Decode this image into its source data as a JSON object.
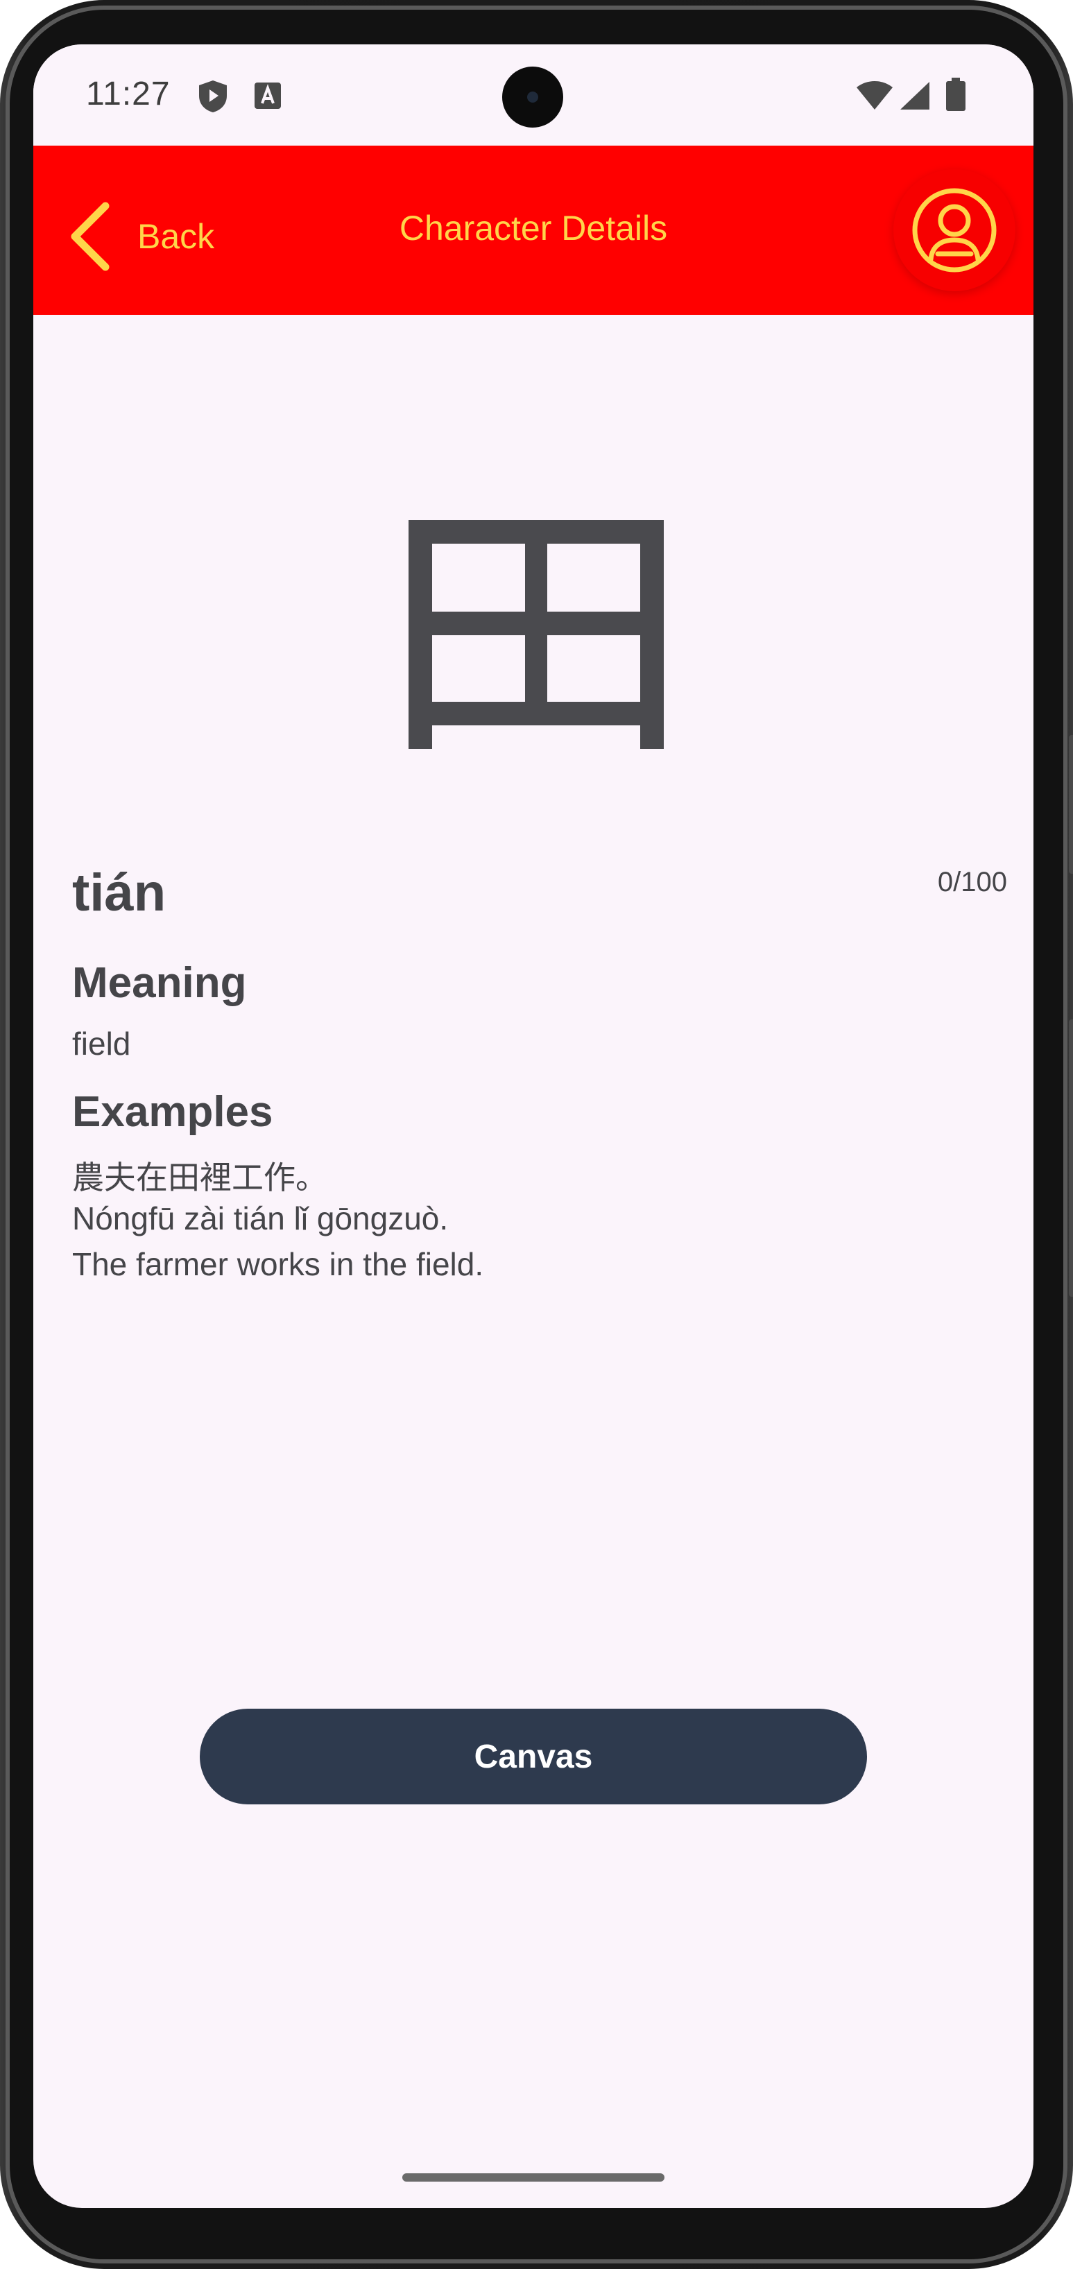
{
  "status_bar": {
    "time": "11:27",
    "icons_left": [
      "shield-play-icon",
      "font-a-icon"
    ],
    "icons_right": [
      "wifi-icon",
      "cellular-signal-icon",
      "battery-icon"
    ]
  },
  "app_bar": {
    "back_label": "Back",
    "title": "Character Details",
    "background": "#ff0000",
    "accent": "#ffd54a",
    "back_icon": "chevron-left-icon",
    "profile_icon": "user-profile-icon"
  },
  "character": {
    "hanzi": "田",
    "pinyin": "tián",
    "progress": "0/100"
  },
  "meaning": {
    "heading": "Meaning",
    "text": "field"
  },
  "examples": {
    "heading": "Examples",
    "hanzi": "農夫在田裡工作。",
    "pinyin": "Nóngfū zài tián lǐ gōngzuò.",
    "english": "The farmer works in the field."
  },
  "actions": {
    "canvas_label": "Canvas",
    "canvas_color": "#2e3a4e"
  }
}
